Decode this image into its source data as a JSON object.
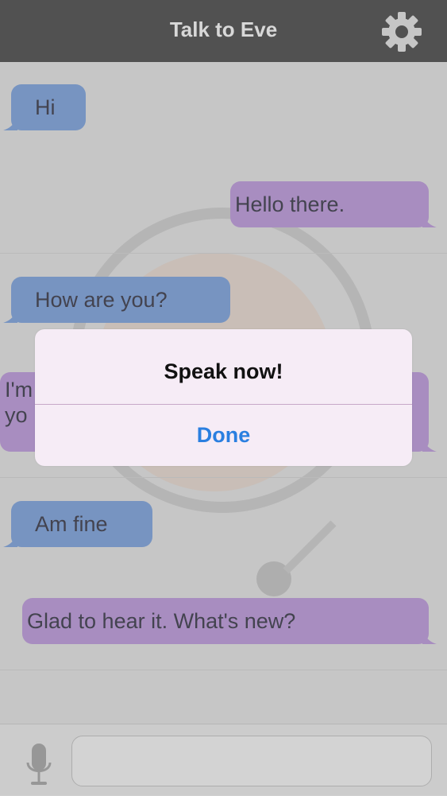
{
  "header": {
    "title": "Talk to Eve"
  },
  "messages": [
    {
      "side": "left",
      "text": "Hi"
    },
    {
      "side": "right",
      "text": "Hello there."
    },
    {
      "side": "left",
      "text": "How are you?"
    },
    {
      "side": "right",
      "text": "I'm fine, how are you?",
      "visible_fragment_line1": "I'm",
      "visible_fragment_line2": "yo"
    },
    {
      "side": "left",
      "text": "Am fine"
    },
    {
      "side": "right",
      "text": "Glad to hear it. What's new?"
    }
  ],
  "alert": {
    "title": "Speak now!",
    "button": "Done"
  },
  "input": {
    "value": "",
    "placeholder": ""
  },
  "icons": {
    "settings": "gear-icon",
    "microphone": "microphone-icon"
  },
  "colors": {
    "header_bg": "#2d2d2d",
    "incoming_bubble": "#5f86c2",
    "outgoing_bubble": "#a07cc0",
    "alert_button": "#2a7fe0"
  }
}
